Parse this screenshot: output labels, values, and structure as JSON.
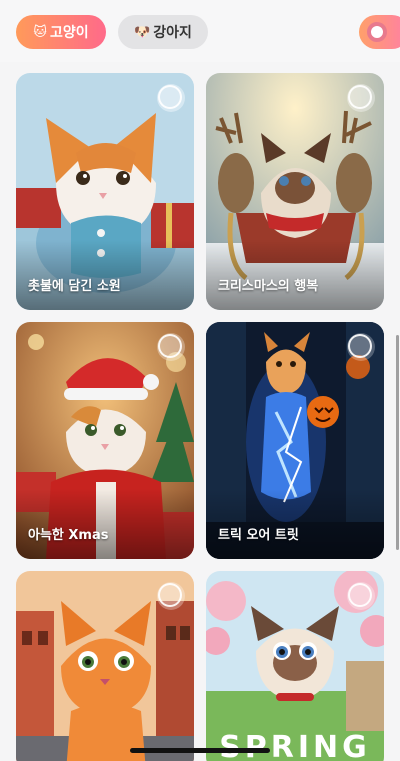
{
  "tabs": [
    {
      "emoji": "🐱",
      "label": "고양이",
      "active": true
    },
    {
      "emoji": "🐶",
      "label": "강아지",
      "active": false
    }
  ],
  "cards": [
    {
      "title": "촛불에 담긴 소원"
    },
    {
      "title": "크리스마스의 행복"
    },
    {
      "title": "아늑한 Xmas"
    },
    {
      "title": "트릭 오어 트릿"
    },
    {
      "title": ""
    },
    {
      "title": "",
      "art_text": "SPRING"
    }
  ],
  "colors": {
    "accent_gradient_start": "#ff9a5a",
    "accent_gradient_end": "#ff6a8a"
  }
}
